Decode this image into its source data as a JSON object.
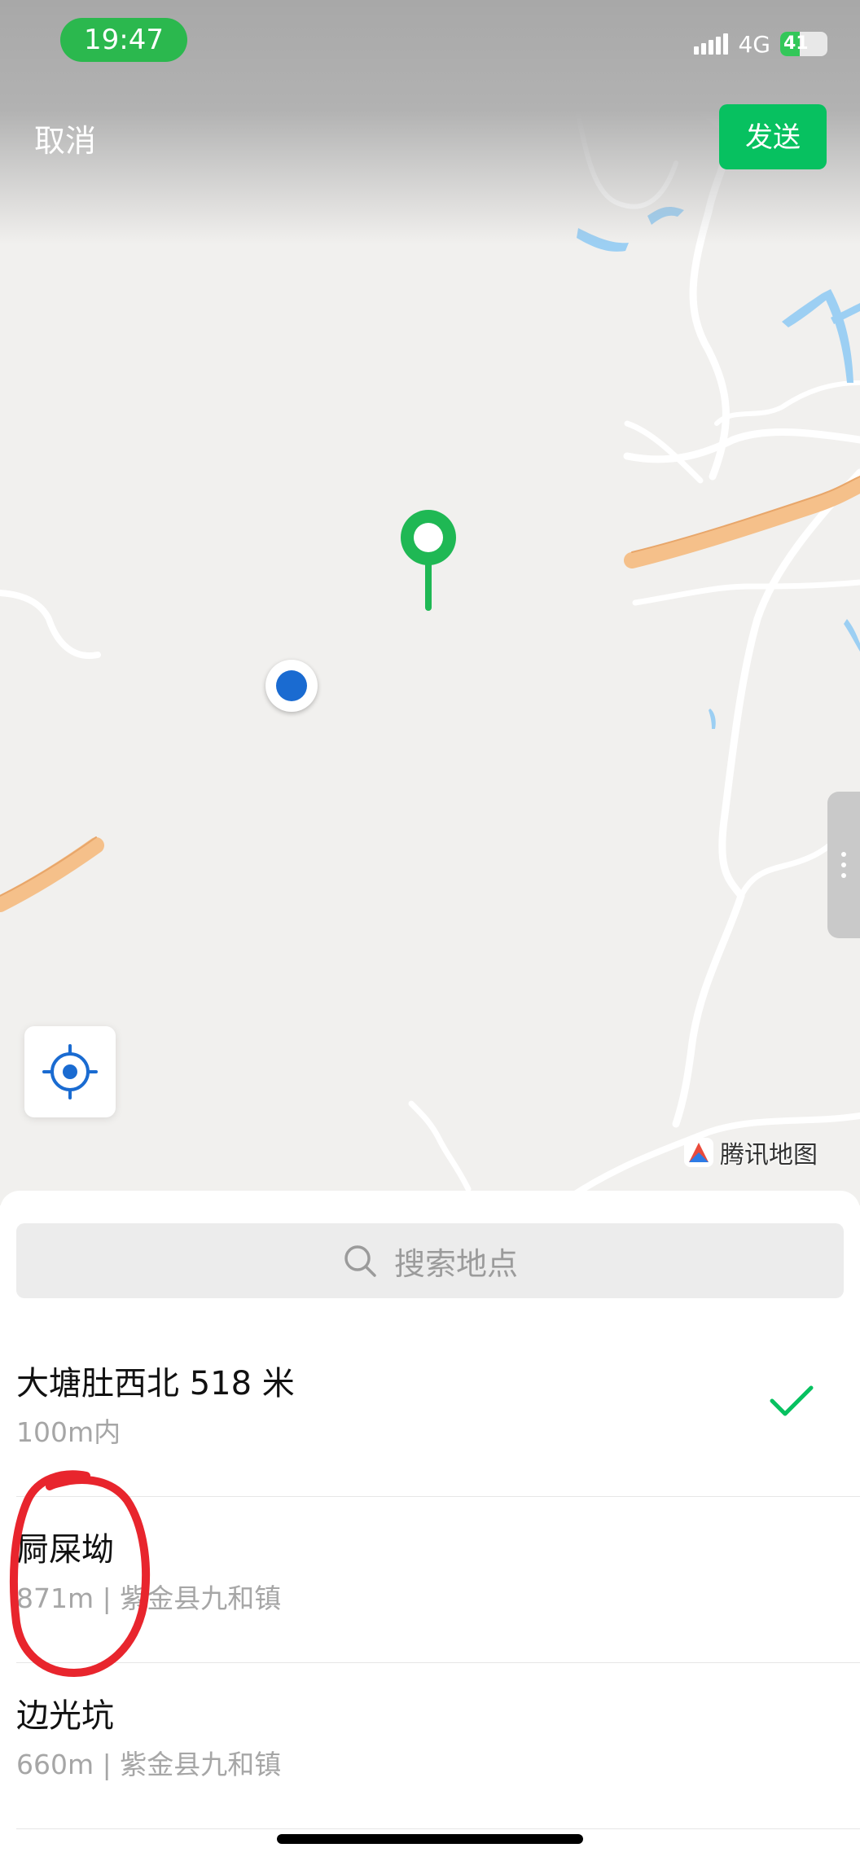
{
  "status_bar": {
    "time": "19:47",
    "network": "4G",
    "battery": "41",
    "battery_level": 0.41
  },
  "header": {
    "cancel_label": "取消",
    "send_label": "发送"
  },
  "map": {
    "brand": "腾讯地图"
  },
  "search": {
    "placeholder": "搜索地点"
  },
  "locations": [
    {
      "title": "大塘肚西北 518 米",
      "subtitle": "100m内",
      "selected": true
    },
    {
      "title": "屙屎坳",
      "subtitle": "871m | 紫金县九和镇",
      "selected": false
    },
    {
      "title": "边光坑",
      "subtitle": "660m | 紫金县九和镇",
      "selected": false
    }
  ],
  "colors": {
    "accent": "#07c160",
    "pin": "#1fb854",
    "my_location": "#1a6bd1",
    "highway": "#f5c08a",
    "water": "#9ccff3",
    "annotation": "#e8252d"
  }
}
